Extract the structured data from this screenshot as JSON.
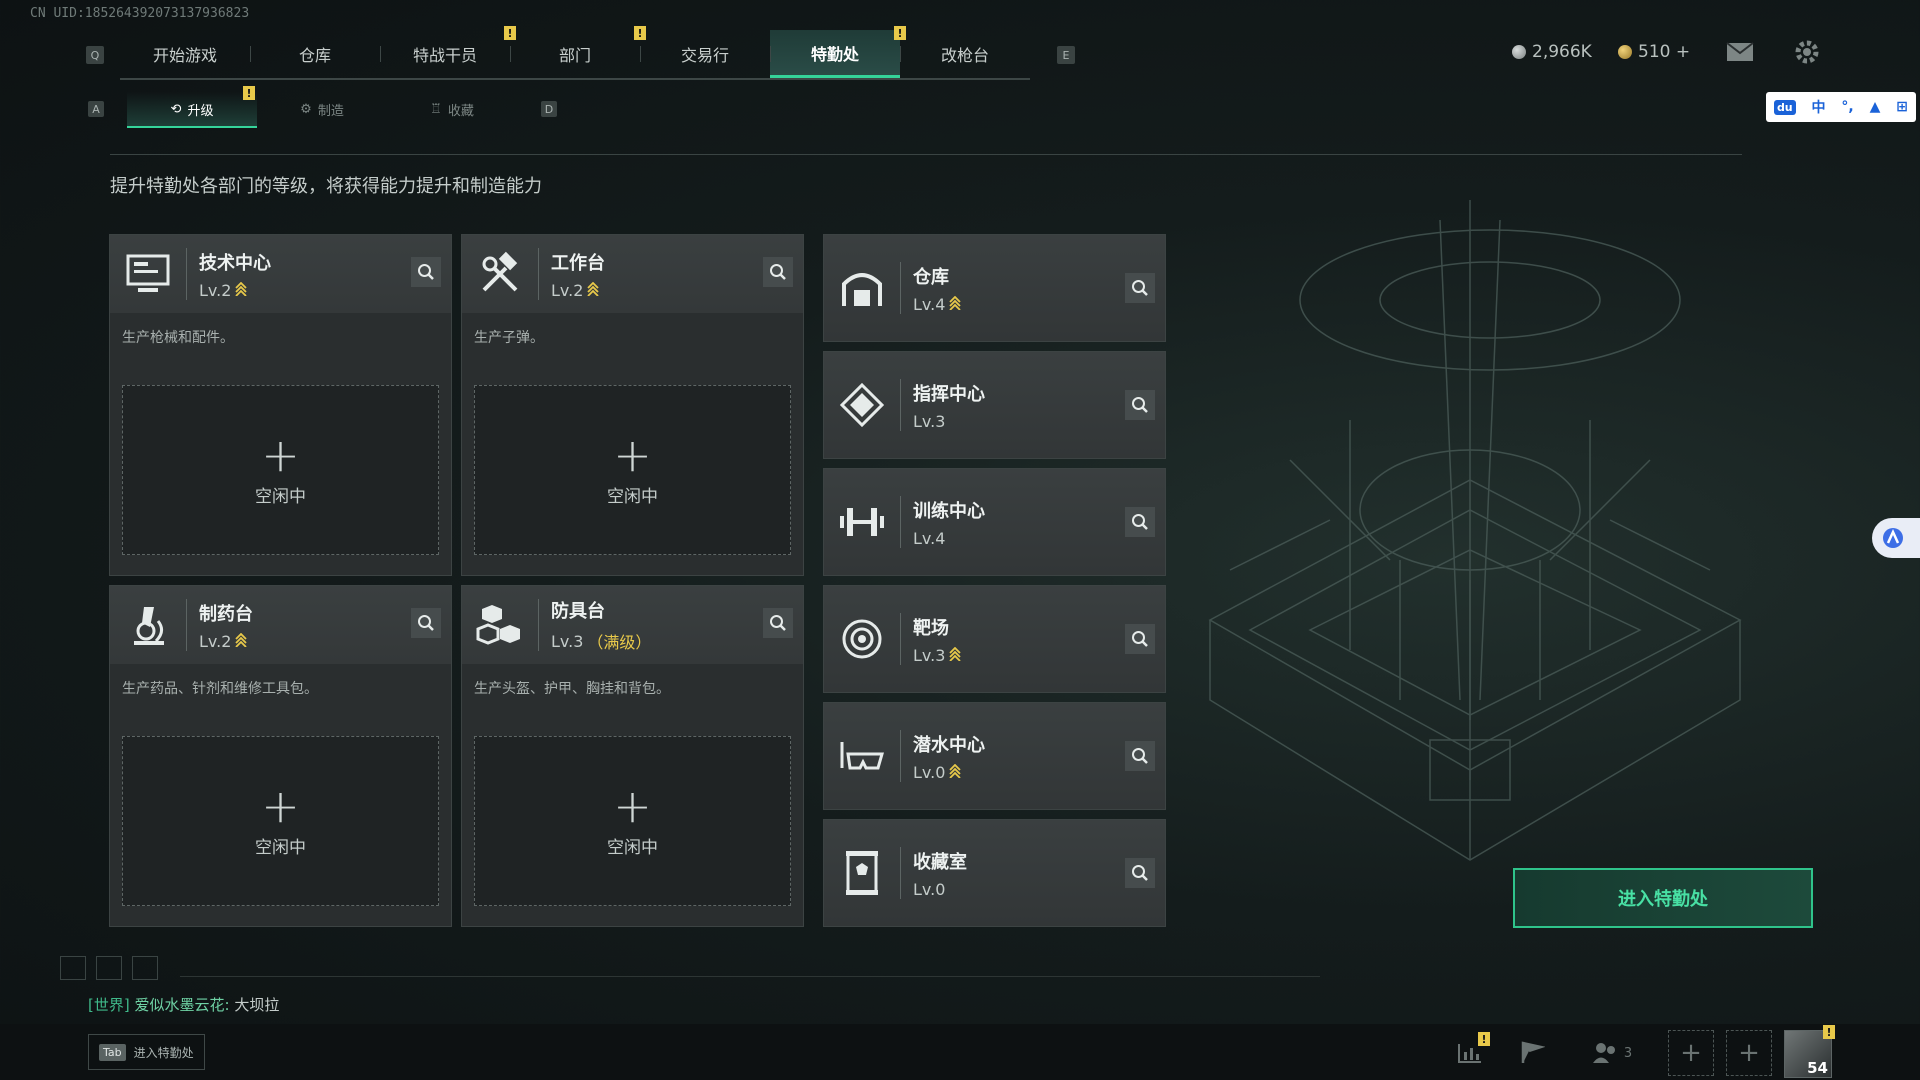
{
  "uid": "CN UID:18526439207313793­6823",
  "topnav": {
    "left_key": "Q",
    "right_key": "E",
    "tabs": [
      {
        "label": "开始游戏",
        "badge": ""
      },
      {
        "label": "仓库",
        "badge": ""
      },
      {
        "label": "特战干员",
        "badge": "!"
      },
      {
        "label": "部门",
        "badge": "!"
      },
      {
        "label": "交易行",
        "badge": ""
      },
      {
        "label": "特勤处",
        "badge": "!",
        "active": true
      },
      {
        "label": "改枪台",
        "badge": ""
      }
    ]
  },
  "currency": {
    "silver": "2,966K",
    "gold": "510 +"
  },
  "subnav": {
    "left_key": "A",
    "right_key": "D",
    "tabs": [
      {
        "label": "升级",
        "badge": "!",
        "active": true
      },
      {
        "label": "制造",
        "badge": ""
      },
      {
        "label": "收藏",
        "badge": ""
      }
    ]
  },
  "description": "提升特勤处各部门的等级，将获得能力提升和制造能力",
  "production_cards": [
    {
      "name": "技术中心",
      "level": "Lv.2",
      "upgradable": true,
      "max": "",
      "icon": "monitor-icon",
      "desc": "生产枪械和配件。",
      "slot_status": "空闲中"
    },
    {
      "name": "工作台",
      "level": "Lv.2",
      "upgradable": true,
      "max": "",
      "icon": "hammer-wrench-icon",
      "desc": "生产子弹。",
      "slot_status": "空闲中"
    },
    {
      "name": "制药台",
      "level": "Lv.2",
      "upgradable": true,
      "max": "",
      "icon": "microscope-icon",
      "desc": "生产药品、针剂和维修工具包。",
      "slot_status": "空闲中"
    },
    {
      "name": "防具台",
      "level": "Lv.3",
      "upgradable": false,
      "max": "（满级）",
      "icon": "cubes-icon",
      "desc": "生产头盔、护甲、胸挂和背包。",
      "slot_status": "空闲中"
    }
  ],
  "facility_cards": [
    {
      "name": "仓库",
      "level": "Lv.4",
      "upgradable": true,
      "icon": "warehouse-icon"
    },
    {
      "name": "指挥中心",
      "level": "Lv.3",
      "upgradable": false,
      "icon": "command-icon"
    },
    {
      "name": "训练中心",
      "level": "Lv.4",
      "upgradable": false,
      "icon": "dumbbell-icon"
    },
    {
      "name": "靶场",
      "level": "Lv.3",
      "upgradable": true,
      "icon": "target-icon"
    },
    {
      "name": "潜水中心",
      "level": "Lv.0",
      "upgradable": true,
      "icon": "diving-mask-icon"
    },
    {
      "name": "收藏室",
      "level": "Lv.0",
      "upgradable": false,
      "icon": "trophy-case-icon"
    }
  ],
  "enter_button": "进入特勤处",
  "chat": {
    "channel": "[世界]",
    "user": "爱似水墨云花:",
    "message": "大坝拉"
  },
  "tab_hint": {
    "key": "Tab",
    "label": "进入特勤处"
  },
  "bottom": {
    "friends_count": "3",
    "player_level": "54"
  },
  "ime": {
    "lang": "中"
  },
  "colors": {
    "accent_green": "#35d49a",
    "badge_yellow": "#e8c94a",
    "card_bg": "#2a2e2f"
  }
}
